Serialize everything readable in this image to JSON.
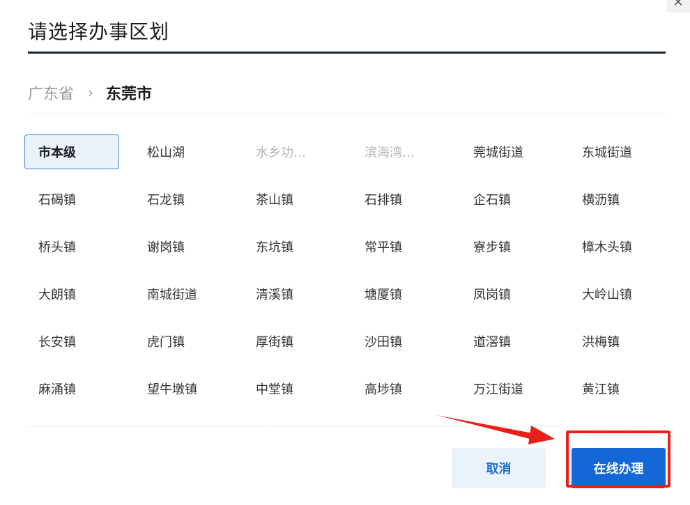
{
  "dialog": {
    "title": "请选择办事区划",
    "close_glyph": "✕"
  },
  "breadcrumb": {
    "root": "广东省",
    "separator": "›",
    "current": "东莞市"
  },
  "districts": [
    {
      "label": "市本级",
      "state": "selected"
    },
    {
      "label": "松山湖",
      "state": "normal"
    },
    {
      "label": "水乡功…",
      "state": "disabled"
    },
    {
      "label": "滨海湾…",
      "state": "disabled"
    },
    {
      "label": "莞城街道",
      "state": "normal"
    },
    {
      "label": "东城街道",
      "state": "normal"
    },
    {
      "label": "石碣镇",
      "state": "normal"
    },
    {
      "label": "石龙镇",
      "state": "normal"
    },
    {
      "label": "茶山镇",
      "state": "normal"
    },
    {
      "label": "石排镇",
      "state": "normal"
    },
    {
      "label": "企石镇",
      "state": "normal"
    },
    {
      "label": "横沥镇",
      "state": "normal"
    },
    {
      "label": "桥头镇",
      "state": "normal"
    },
    {
      "label": "谢岗镇",
      "state": "normal"
    },
    {
      "label": "东坑镇",
      "state": "normal"
    },
    {
      "label": "常平镇",
      "state": "normal"
    },
    {
      "label": "寮步镇",
      "state": "normal"
    },
    {
      "label": "樟木头镇",
      "state": "normal"
    },
    {
      "label": "大朗镇",
      "state": "normal"
    },
    {
      "label": "南城街道",
      "state": "normal"
    },
    {
      "label": "清溪镇",
      "state": "normal"
    },
    {
      "label": "塘厦镇",
      "state": "normal"
    },
    {
      "label": "凤岗镇",
      "state": "normal"
    },
    {
      "label": "大岭山镇",
      "state": "normal"
    },
    {
      "label": "长安镇",
      "state": "normal"
    },
    {
      "label": "虎门镇",
      "state": "normal"
    },
    {
      "label": "厚街镇",
      "state": "normal"
    },
    {
      "label": "沙田镇",
      "state": "normal"
    },
    {
      "label": "道滘镇",
      "state": "normal"
    },
    {
      "label": "洪梅镇",
      "state": "normal"
    },
    {
      "label": "麻涌镇",
      "state": "normal"
    },
    {
      "label": "望牛墩镇",
      "state": "normal"
    },
    {
      "label": "中堂镇",
      "state": "normal"
    },
    {
      "label": "高埗镇",
      "state": "normal"
    },
    {
      "label": "万江街道",
      "state": "normal"
    },
    {
      "label": "黄江镇",
      "state": "normal"
    }
  ],
  "footer": {
    "cancel_label": "取消",
    "primary_label": "在线办理"
  },
  "colors": {
    "primary": "#1467d6",
    "annotation_red": "#e8201a",
    "selected_bg": "#e9f1fb"
  }
}
